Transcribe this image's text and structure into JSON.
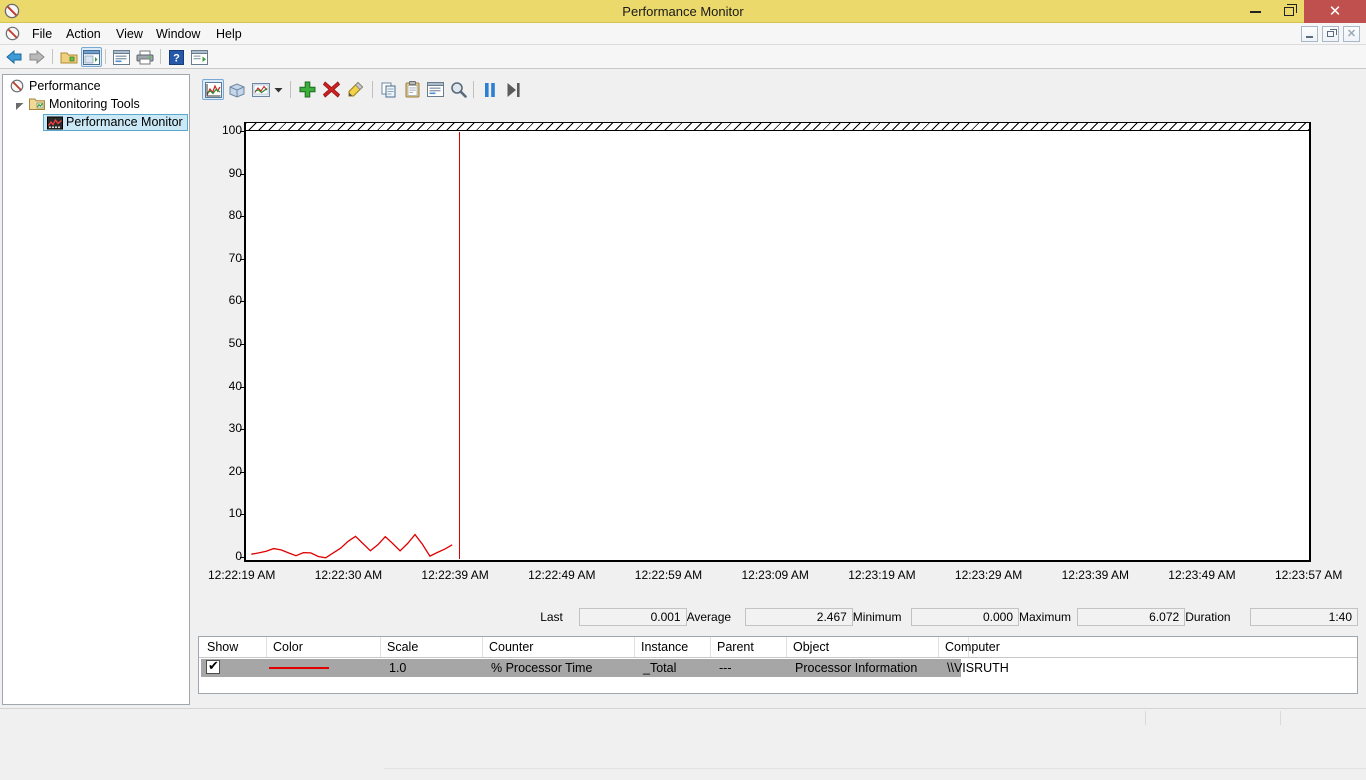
{
  "window": {
    "title": "Performance Monitor",
    "app_icon": "perfmon-icon",
    "minimize": "–",
    "maximize": "❐",
    "close": "✕"
  },
  "menubar": {
    "items": [
      {
        "label": "File",
        "name": "menu-file"
      },
      {
        "label": "Action",
        "name": "menu-action"
      },
      {
        "label": "View",
        "name": "menu-view"
      },
      {
        "label": "Window",
        "name": "menu-window"
      },
      {
        "label": "Help",
        "name": "menu-help"
      }
    ]
  },
  "toolbar": {
    "items": [
      {
        "name": "back-icon",
        "title": "Back"
      },
      {
        "name": "forward-icon",
        "title": "Forward"
      },
      {
        "name": "show-console-tree-icon",
        "title": "Show/Hide Console Tree"
      },
      {
        "name": "show-action-pane-icon",
        "title": "Show/Hide Action Pane"
      },
      {
        "name": "properties-icon",
        "title": "Properties"
      },
      {
        "name": "print-icon",
        "title": "Print"
      },
      {
        "name": "help-icon",
        "title": "Help"
      },
      {
        "name": "new-window-icon",
        "title": "New Window"
      }
    ]
  },
  "tree": {
    "nodes": [
      {
        "label": "Performance",
        "name": "tree-node-performance",
        "icon": "perfmon-icon",
        "indent": 0,
        "selected": false
      },
      {
        "label": "Monitoring Tools",
        "name": "tree-node-monitoring-tools",
        "icon": "folder-tools-icon",
        "indent": 1,
        "selected": false
      },
      {
        "label": "Performance Monitor",
        "name": "tree-node-performance-monitor",
        "icon": "chart-icon",
        "indent": 2,
        "selected": true
      }
    ]
  },
  "graph_toolbar": {
    "items": [
      {
        "name": "view-graph-icon",
        "title": "View Graph",
        "selected": true
      },
      {
        "name": "view-3d-icon",
        "title": "View Histogram"
      },
      {
        "name": "change-graph-type-icon",
        "title": "Change Graph Type"
      },
      {
        "name": "chevron-down-icon",
        "title": "More graph types"
      },
      {
        "name": "add-counter-icon",
        "title": "Add"
      },
      {
        "name": "delete-counter-icon",
        "title": "Delete"
      },
      {
        "name": "highlight-icon",
        "title": "Highlight"
      },
      {
        "name": "copy-properties-icon",
        "title": "Copy Properties"
      },
      {
        "name": "paste-counter-list-icon",
        "title": "Paste Counter List"
      },
      {
        "name": "properties-icon",
        "title": "Properties"
      },
      {
        "name": "zoom-icon",
        "title": "Zoom To"
      },
      {
        "name": "freeze-display-icon",
        "title": "Freeze Display"
      },
      {
        "name": "update-data-icon",
        "title": "Update Data"
      }
    ]
  },
  "chart_data": {
    "type": "line",
    "title": "",
    "xlabel": "",
    "ylabel": "",
    "ylim": [
      0,
      100
    ],
    "ytick_values": [
      0,
      10,
      20,
      30,
      40,
      50,
      60,
      70,
      80,
      90,
      100
    ],
    "ytick_labels": [
      "0",
      "10",
      "20",
      "30",
      "40",
      "50",
      "60",
      "70",
      "80",
      "90",
      "100"
    ],
    "xtick_labels": [
      "12:22:19 AM",
      "12:22:30 AM",
      "12:22:39 AM",
      "12:22:49 AM",
      "12:22:59 AM",
      "12:23:09 AM",
      "12:23:19 AM",
      "12:23:29 AM",
      "12:23:39 AM",
      "12:23:49 AM",
      "12:23:57 AM"
    ],
    "grid": false,
    "legend_position": "bottom-table",
    "series": [
      {
        "name": "% Processor Time",
        "color": "#e00000",
        "scale": 1.0,
        "x_fraction": [
          0.005,
          0.012,
          0.019,
          0.026,
          0.033,
          0.04,
          0.047,
          0.054,
          0.061,
          0.068,
          0.075,
          0.082,
          0.089,
          0.096,
          0.103,
          0.11,
          0.117,
          0.124,
          0.131,
          0.138,
          0.145,
          0.152,
          0.159,
          0.166,
          0.173,
          0.18,
          0.187,
          0.194
        ],
        "values": [
          0.9,
          1.2,
          1.6,
          2.2,
          1.9,
          1.2,
          0.55,
          1.25,
          1.2,
          0.35,
          0.05,
          1.2,
          2.3,
          3.9,
          5.1,
          3.4,
          1.7,
          3.1,
          5.0,
          3.4,
          1.7,
          3.4,
          5.5,
          3.2,
          0.45,
          1.3,
          2.1,
          3.1
        ]
      }
    ],
    "time_cursor_fraction": 0.2,
    "hatched_top_band": true
  },
  "stats": {
    "fields": [
      {
        "label": "Last",
        "value": "0.001",
        "name": "stat-last"
      },
      {
        "label": "Average",
        "value": "2.467",
        "name": "stat-average"
      },
      {
        "label": "Minimum",
        "value": "0.000",
        "name": "stat-minimum"
      },
      {
        "label": "Maximum",
        "value": "6.072",
        "name": "stat-maximum"
      },
      {
        "label": "Duration",
        "value": "1:40",
        "name": "stat-duration"
      }
    ]
  },
  "legend": {
    "columns": [
      "Show",
      "Color",
      "Scale",
      "Counter",
      "Instance",
      "Parent",
      "Object",
      "Computer"
    ],
    "rows": [
      {
        "show": true,
        "color": "#e00000",
        "scale": "1.0",
        "counter": "% Processor Time",
        "instance": "_Total",
        "parent": "---",
        "object": "Processor Information",
        "computer": "\\\\VISRUTH"
      }
    ]
  },
  "statusbar": {
    "text": ""
  },
  "colors": {
    "title_bar": "#ebd96b",
    "close_button": "#c0504d",
    "accent_selection": "#cbe8f6",
    "trace": "#e00000",
    "row_selected": "#a6a6a6"
  }
}
